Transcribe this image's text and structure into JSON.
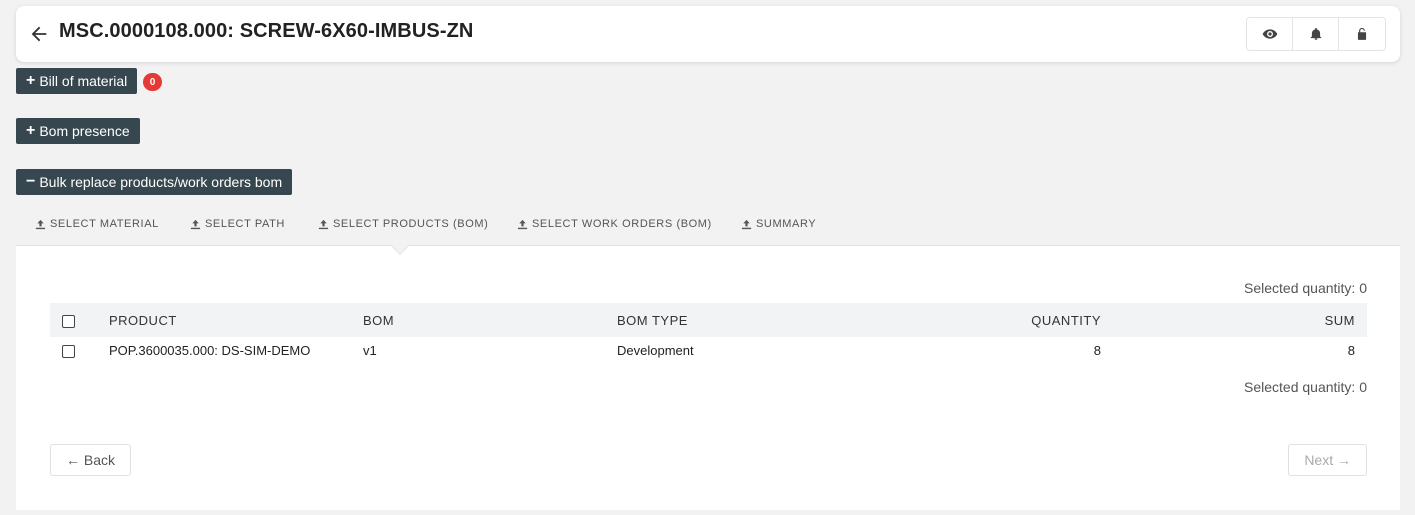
{
  "header": {
    "title": "MSC.0000108.000: SCREW-6X60-IMBUS-ZN",
    "actions": [
      {
        "icon": "eye-icon"
      },
      {
        "icon": "bell-icon"
      },
      {
        "icon": "unlock-icon"
      }
    ]
  },
  "sections": {
    "bill_of_material": {
      "label": "Bill of material",
      "badge": "0",
      "symbol": "+"
    },
    "bom_presence": {
      "label": "Bom presence",
      "symbol": "+"
    },
    "bulk_replace": {
      "label": "Bulk replace products/work orders bom",
      "symbol": "−"
    }
  },
  "tabs": [
    {
      "label": "SELECT MATERIAL",
      "icon": "upload-icon"
    },
    {
      "label": "SELECT PATH",
      "icon": "upload-icon"
    },
    {
      "label": "SELECT PRODUCTS (BOM)",
      "icon": "upload-icon",
      "active": true
    },
    {
      "label": "SELECT WORK ORDERS (BOM)",
      "icon": "upload-icon"
    },
    {
      "label": "SUMMARY",
      "icon": "upload-icon"
    }
  ],
  "selection": {
    "top_label": "Selected quantity: 0",
    "bottom_label": "Selected quantity: 0"
  },
  "table": {
    "columns": [
      "PRODUCT",
      "BOM",
      "BOM TYPE",
      "QUANTITY",
      "SUM"
    ],
    "rows": [
      {
        "product": "POP.3600035.000: DS-SIM-DEMO",
        "bom": "v1",
        "bom_type": "Development",
        "quantity": "8",
        "sum": "8"
      }
    ]
  },
  "nav": {
    "back_label": "← Back",
    "next_label": "Next →"
  },
  "colors": {
    "dark_button": "#37474f",
    "badge": "#e53935",
    "background": "#f2f2f2"
  }
}
